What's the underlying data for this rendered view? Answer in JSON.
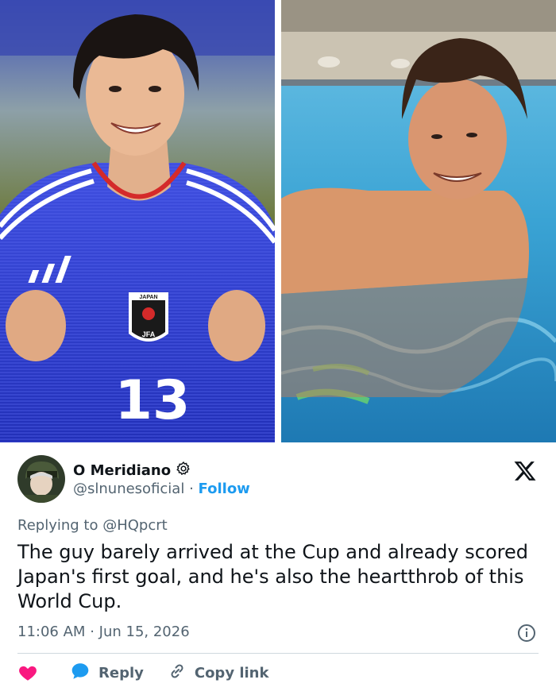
{
  "tweet": {
    "display_name": "O Meridiano",
    "handle": "@slnunesoficial",
    "separator": "·",
    "follow_label": "Follow",
    "replying_prefix": "Replying to",
    "replying_to": "@HQpcrt",
    "text": "The guy barely arrived at the Cup and already scored Japan's first goal, and he's also the heartthrob of this World Cup.",
    "time": "11:06 AM",
    "date": "Jun 15, 2026",
    "actions": {
      "reply_label": "Reply",
      "copy_link_label": "Copy link"
    }
  },
  "photo_left": {
    "jersey_text": "JAPAN",
    "crest_text": "JFA",
    "number": "13"
  },
  "icons": [
    "gear-icon",
    "x-logo-icon",
    "info-icon",
    "heart-icon",
    "reply-bubble-icon",
    "link-icon"
  ],
  "colors": {
    "link_blue": "#1d9bf0",
    "heart_pink": "#f91880",
    "muted_text": "#536471",
    "jersey_blue": "#2f3fd1"
  }
}
